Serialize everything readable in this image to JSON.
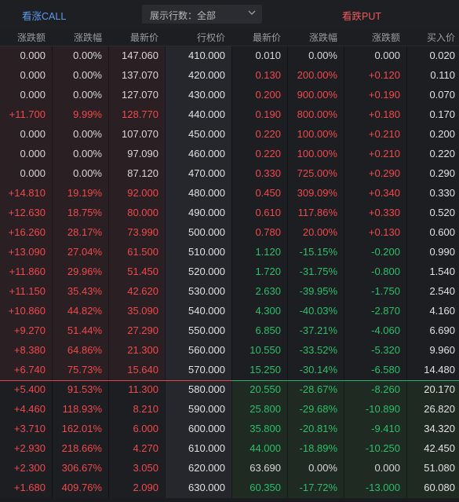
{
  "toolbar": {
    "call_label": "看涨CALL",
    "put_label": "看跌PUT",
    "rows_selector_label": "展示行数：全部"
  },
  "columns": [
    "涨跌额",
    "涨跌幅",
    "最新价",
    "行权价",
    "最新价",
    "涨跌幅",
    "涨跌额",
    "买入价"
  ],
  "colors": {
    "up": "#f0494c",
    "down": "#2cbf6a",
    "flat": "#d8d8d8",
    "call_in_money_bg": "#2a1f22",
    "put_in_money_bg": "#1e2a22",
    "strike_bg": "#25272c"
  },
  "atm_after_row": 16,
  "rows": [
    {
      "c_chg": "0.000",
      "c_pct": "0.00%",
      "c_last": "147.060",
      "strike": "410.000",
      "p_last": "0.010",
      "p_pct": "0.00%",
      "p_chg": "0.000",
      "p_bid": "0.020",
      "c_dir": "flat",
      "p_dir": "flat"
    },
    {
      "c_chg": "0.000",
      "c_pct": "0.00%",
      "c_last": "137.070",
      "strike": "420.000",
      "p_last": "0.130",
      "p_pct": "200.00%",
      "p_chg": "+0.120",
      "p_bid": "0.110",
      "c_dir": "flat",
      "p_dir": "up"
    },
    {
      "c_chg": "0.000",
      "c_pct": "0.00%",
      "c_last": "127.070",
      "strike": "430.000",
      "p_last": "0.200",
      "p_pct": "900.00%",
      "p_chg": "+0.190",
      "p_bid": "0.070",
      "c_dir": "flat",
      "p_dir": "up"
    },
    {
      "c_chg": "+11.700",
      "c_pct": "9.99%",
      "c_last": "128.770",
      "strike": "440.000",
      "p_last": "0.190",
      "p_pct": "800.00%",
      "p_chg": "+0.180",
      "p_bid": "0.170",
      "c_dir": "up",
      "p_dir": "up"
    },
    {
      "c_chg": "0.000",
      "c_pct": "0.00%",
      "c_last": "107.070",
      "strike": "450.000",
      "p_last": "0.220",
      "p_pct": "100.00%",
      "p_chg": "+0.210",
      "p_bid": "0.200",
      "c_dir": "flat",
      "p_dir": "up"
    },
    {
      "c_chg": "0.000",
      "c_pct": "0.00%",
      "c_last": "97.090",
      "strike": "460.000",
      "p_last": "0.220",
      "p_pct": "100.00%",
      "p_chg": "+0.210",
      "p_bid": "0.220",
      "c_dir": "flat",
      "p_dir": "up"
    },
    {
      "c_chg": "0.000",
      "c_pct": "0.00%",
      "c_last": "87.120",
      "strike": "470.000",
      "p_last": "0.330",
      "p_pct": "725.00%",
      "p_chg": "+0.290",
      "p_bid": "0.290",
      "c_dir": "flat",
      "p_dir": "up"
    },
    {
      "c_chg": "+14.810",
      "c_pct": "19.19%",
      "c_last": "92.000",
      "strike": "480.000",
      "p_last": "0.450",
      "p_pct": "309.09%",
      "p_chg": "+0.340",
      "p_bid": "0.330",
      "c_dir": "up",
      "p_dir": "up"
    },
    {
      "c_chg": "+12.630",
      "c_pct": "18.75%",
      "c_last": "80.000",
      "strike": "490.000",
      "p_last": "0.610",
      "p_pct": "117.86%",
      "p_chg": "+0.330",
      "p_bid": "0.520",
      "c_dir": "up",
      "p_dir": "up"
    },
    {
      "c_chg": "+16.260",
      "c_pct": "28.17%",
      "c_last": "73.990",
      "strike": "500.000",
      "p_last": "0.780",
      "p_pct": "20.00%",
      "p_chg": "+0.130",
      "p_bid": "0.600",
      "c_dir": "up",
      "p_dir": "up"
    },
    {
      "c_chg": "+13.090",
      "c_pct": "27.04%",
      "c_last": "61.500",
      "strike": "510.000",
      "p_last": "1.120",
      "p_pct": "-15.15%",
      "p_chg": "-0.200",
      "p_bid": "0.990",
      "c_dir": "up",
      "p_dir": "down"
    },
    {
      "c_chg": "+11.860",
      "c_pct": "29.96%",
      "c_last": "51.450",
      "strike": "520.000",
      "p_last": "1.720",
      "p_pct": "-31.75%",
      "p_chg": "-0.800",
      "p_bid": "1.540",
      "c_dir": "up",
      "p_dir": "down"
    },
    {
      "c_chg": "+11.150",
      "c_pct": "35.43%",
      "c_last": "42.620",
      "strike": "530.000",
      "p_last": "2.630",
      "p_pct": "-39.95%",
      "p_chg": "-1.750",
      "p_bid": "2.540",
      "c_dir": "up",
      "p_dir": "down"
    },
    {
      "c_chg": "+10.860",
      "c_pct": "44.82%",
      "c_last": "35.090",
      "strike": "540.000",
      "p_last": "4.300",
      "p_pct": "-40.03%",
      "p_chg": "-2.870",
      "p_bid": "4.160",
      "c_dir": "up",
      "p_dir": "down"
    },
    {
      "c_chg": "+9.270",
      "c_pct": "51.44%",
      "c_last": "27.290",
      "strike": "550.000",
      "p_last": "6.850",
      "p_pct": "-37.21%",
      "p_chg": "-4.060",
      "p_bid": "6.690",
      "c_dir": "up",
      "p_dir": "down"
    },
    {
      "c_chg": "+8.380",
      "c_pct": "64.86%",
      "c_last": "21.300",
      "strike": "560.000",
      "p_last": "10.550",
      "p_pct": "-33.52%",
      "p_chg": "-5.320",
      "p_bid": "9.960",
      "c_dir": "up",
      "p_dir": "down"
    },
    {
      "c_chg": "+6.740",
      "c_pct": "75.73%",
      "c_last": "15.640",
      "strike": "570.000",
      "p_last": "15.250",
      "p_pct": "-30.14%",
      "p_chg": "-6.580",
      "p_bid": "14.480",
      "c_dir": "up",
      "p_dir": "down"
    },
    {
      "c_chg": "+5.400",
      "c_pct": "91.53%",
      "c_last": "11.300",
      "strike": "580.000",
      "p_last": "20.550",
      "p_pct": "-28.67%",
      "p_chg": "-8.260",
      "p_bid": "20.170",
      "c_dir": "up",
      "p_dir": "down"
    },
    {
      "c_chg": "+4.460",
      "c_pct": "118.93%",
      "c_last": "8.210",
      "strike": "590.000",
      "p_last": "25.800",
      "p_pct": "-29.68%",
      "p_chg": "-10.890",
      "p_bid": "26.820",
      "c_dir": "up",
      "p_dir": "down"
    },
    {
      "c_chg": "+3.710",
      "c_pct": "162.01%",
      "c_last": "6.000",
      "strike": "600.000",
      "p_last": "35.800",
      "p_pct": "-20.81%",
      "p_chg": "-9.410",
      "p_bid": "34.320",
      "c_dir": "up",
      "p_dir": "down"
    },
    {
      "c_chg": "+2.930",
      "c_pct": "218.66%",
      "c_last": "4.270",
      "strike": "610.000",
      "p_last": "44.000",
      "p_pct": "-18.89%",
      "p_chg": "-10.250",
      "p_bid": "42.450",
      "c_dir": "up",
      "p_dir": "down"
    },
    {
      "c_chg": "+2.300",
      "c_pct": "306.67%",
      "c_last": "3.050",
      "strike": "620.000",
      "p_last": "63.690",
      "p_pct": "0.00%",
      "p_chg": "0.000",
      "p_bid": "51.080",
      "c_dir": "up",
      "p_dir": "flat"
    },
    {
      "c_chg": "+1.680",
      "c_pct": "409.76%",
      "c_last": "2.090",
      "strike": "630.000",
      "p_last": "60.350",
      "p_pct": "-17.72%",
      "p_chg": "-13.000",
      "p_bid": "60.080",
      "c_dir": "up",
      "p_dir": "down"
    }
  ]
}
